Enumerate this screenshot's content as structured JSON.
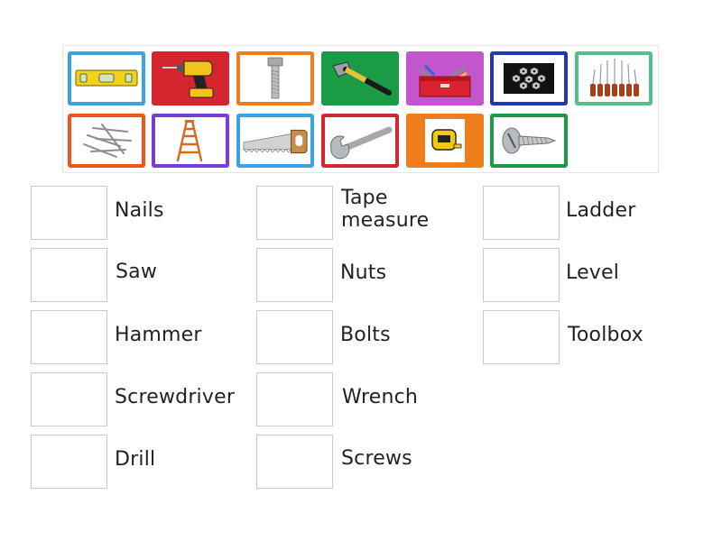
{
  "tiles": [
    {
      "icon": "level-icon",
      "border": "#3aa3e3",
      "bg": "#ffffff"
    },
    {
      "icon": "drill-icon",
      "border": "#d4262e",
      "bg": "#d4262e"
    },
    {
      "icon": "bolt-icon",
      "border": "#f07d1b",
      "bg": "#ffffff"
    },
    {
      "icon": "hammer-icon",
      "border": "#1b9b45",
      "bg": "#1b9b45"
    },
    {
      "icon": "toolbox-icon",
      "border": "#c256cf",
      "bg": "#c256cf"
    },
    {
      "icon": "nuts-icon",
      "border": "#2436b0",
      "bg": "#ffffff"
    },
    {
      "icon": "screwdrivers-icon",
      "border": "#52c08a",
      "bg": "#ffffff"
    },
    {
      "icon": "nails-icon",
      "border": "#f2541e",
      "bg": "#ffffff"
    },
    {
      "icon": "ladder-icon",
      "border": "#7b3bdb",
      "bg": "#ffffff"
    },
    {
      "icon": "saw-icon",
      "border": "#3aa3e3",
      "bg": "#ffffff"
    },
    {
      "icon": "wrench-icon",
      "border": "#d4262e",
      "bg": "#ffffff"
    },
    {
      "icon": "tape-measure-icon",
      "border": "#f07d1b",
      "bg": "#f07d1b"
    },
    {
      "icon": "screw-icon",
      "border": "#1b9b45",
      "bg": "#ffffff"
    }
  ],
  "words": {
    "nails": "Nails",
    "saw": "Saw",
    "hammer": "Hammer",
    "screwdriver": "Screwdriver",
    "drill": "Drill",
    "tape_measure": "Tape measure",
    "nuts": "Nuts",
    "bolts": "Bolts",
    "wrench": "Wrench",
    "screws": "Screws",
    "ladder": "Ladder",
    "level": "Level",
    "toolbox": "Toolbox"
  }
}
